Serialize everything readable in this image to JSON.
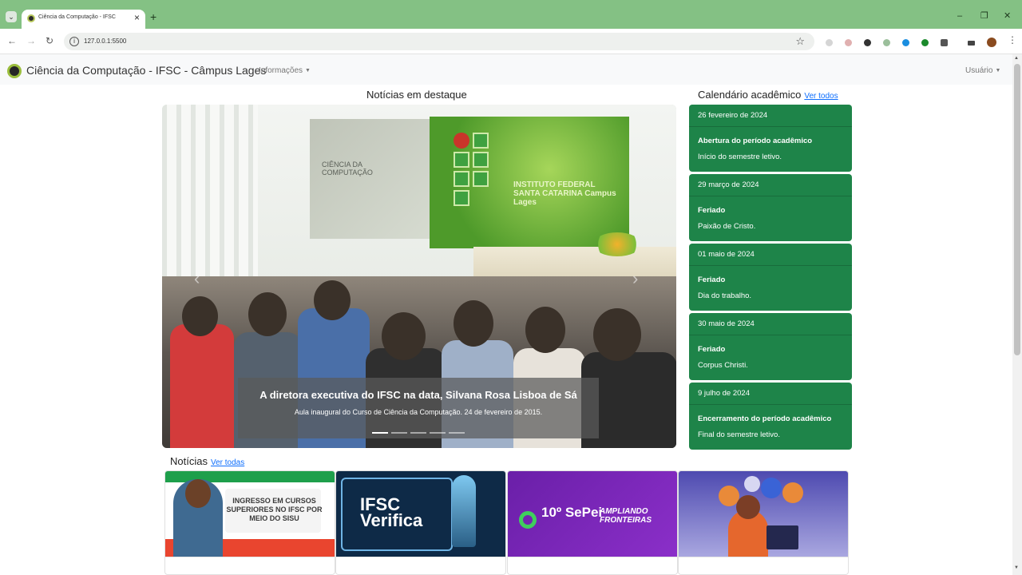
{
  "browser": {
    "tab_title": "Ciência da Computação - IFSC",
    "url": "127.0.0.1:5500"
  },
  "navbar": {
    "brand": "Ciência da Computação - IFSC - Câmpus Lages",
    "menu_info": "Informações",
    "menu_user": "Usuário"
  },
  "featured": {
    "title": "Notícias em destaque",
    "slide_title": "A diretora executiva do IFSC na data, Silvana Rosa Lisboa de Sá",
    "slide_caption": "Aula inaugural do Curso de Ciência da Computação. 24 de fevereiro de 2015.",
    "slide_count": 5,
    "active_slide": 1,
    "photo_screen_left": "CIÊNCIA DA COMPUTAÇÃO",
    "photo_screen_right": "INSTITUTO FEDERAL SANTA CATARINA Campus Lages"
  },
  "calendar": {
    "title": "Calendário acadêmico",
    "see_all": "Ver todos",
    "events": [
      {
        "date": "26 fevereiro de 2024",
        "name": "Abertura do período acadêmico",
        "desc": "Início do semestre letivo."
      },
      {
        "date": "29 março de 2024",
        "name": "Feriado",
        "desc": "Paixão de Cristo."
      },
      {
        "date": "01 maio de 2024",
        "name": "Feriado",
        "desc": "Dia do trabalho."
      },
      {
        "date": "30 maio de 2024",
        "name": "Feriado",
        "desc": "Corpus Christi."
      },
      {
        "date": "9 julho de 2024",
        "name": "Encerramento do período acadêmico",
        "desc": "Final do semestre letivo."
      }
    ]
  },
  "news": {
    "title": "Notícias",
    "see_all": "Ver todas",
    "cards": [
      {
        "image_text": "INGRESSO EM CURSOS SUPERIORES NO IFSC POR MEIO DO SISU"
      },
      {
        "image_text": "IFSC Verifica"
      },
      {
        "image_text": "10º SePei",
        "image_text_2": "AMPLIANDO FRONTEIRAS"
      },
      {
        "image_text": ""
      }
    ]
  },
  "colors": {
    "tab_strip": "#84c184",
    "calendar_card": "#1e8449",
    "link": "#0d6efd"
  }
}
